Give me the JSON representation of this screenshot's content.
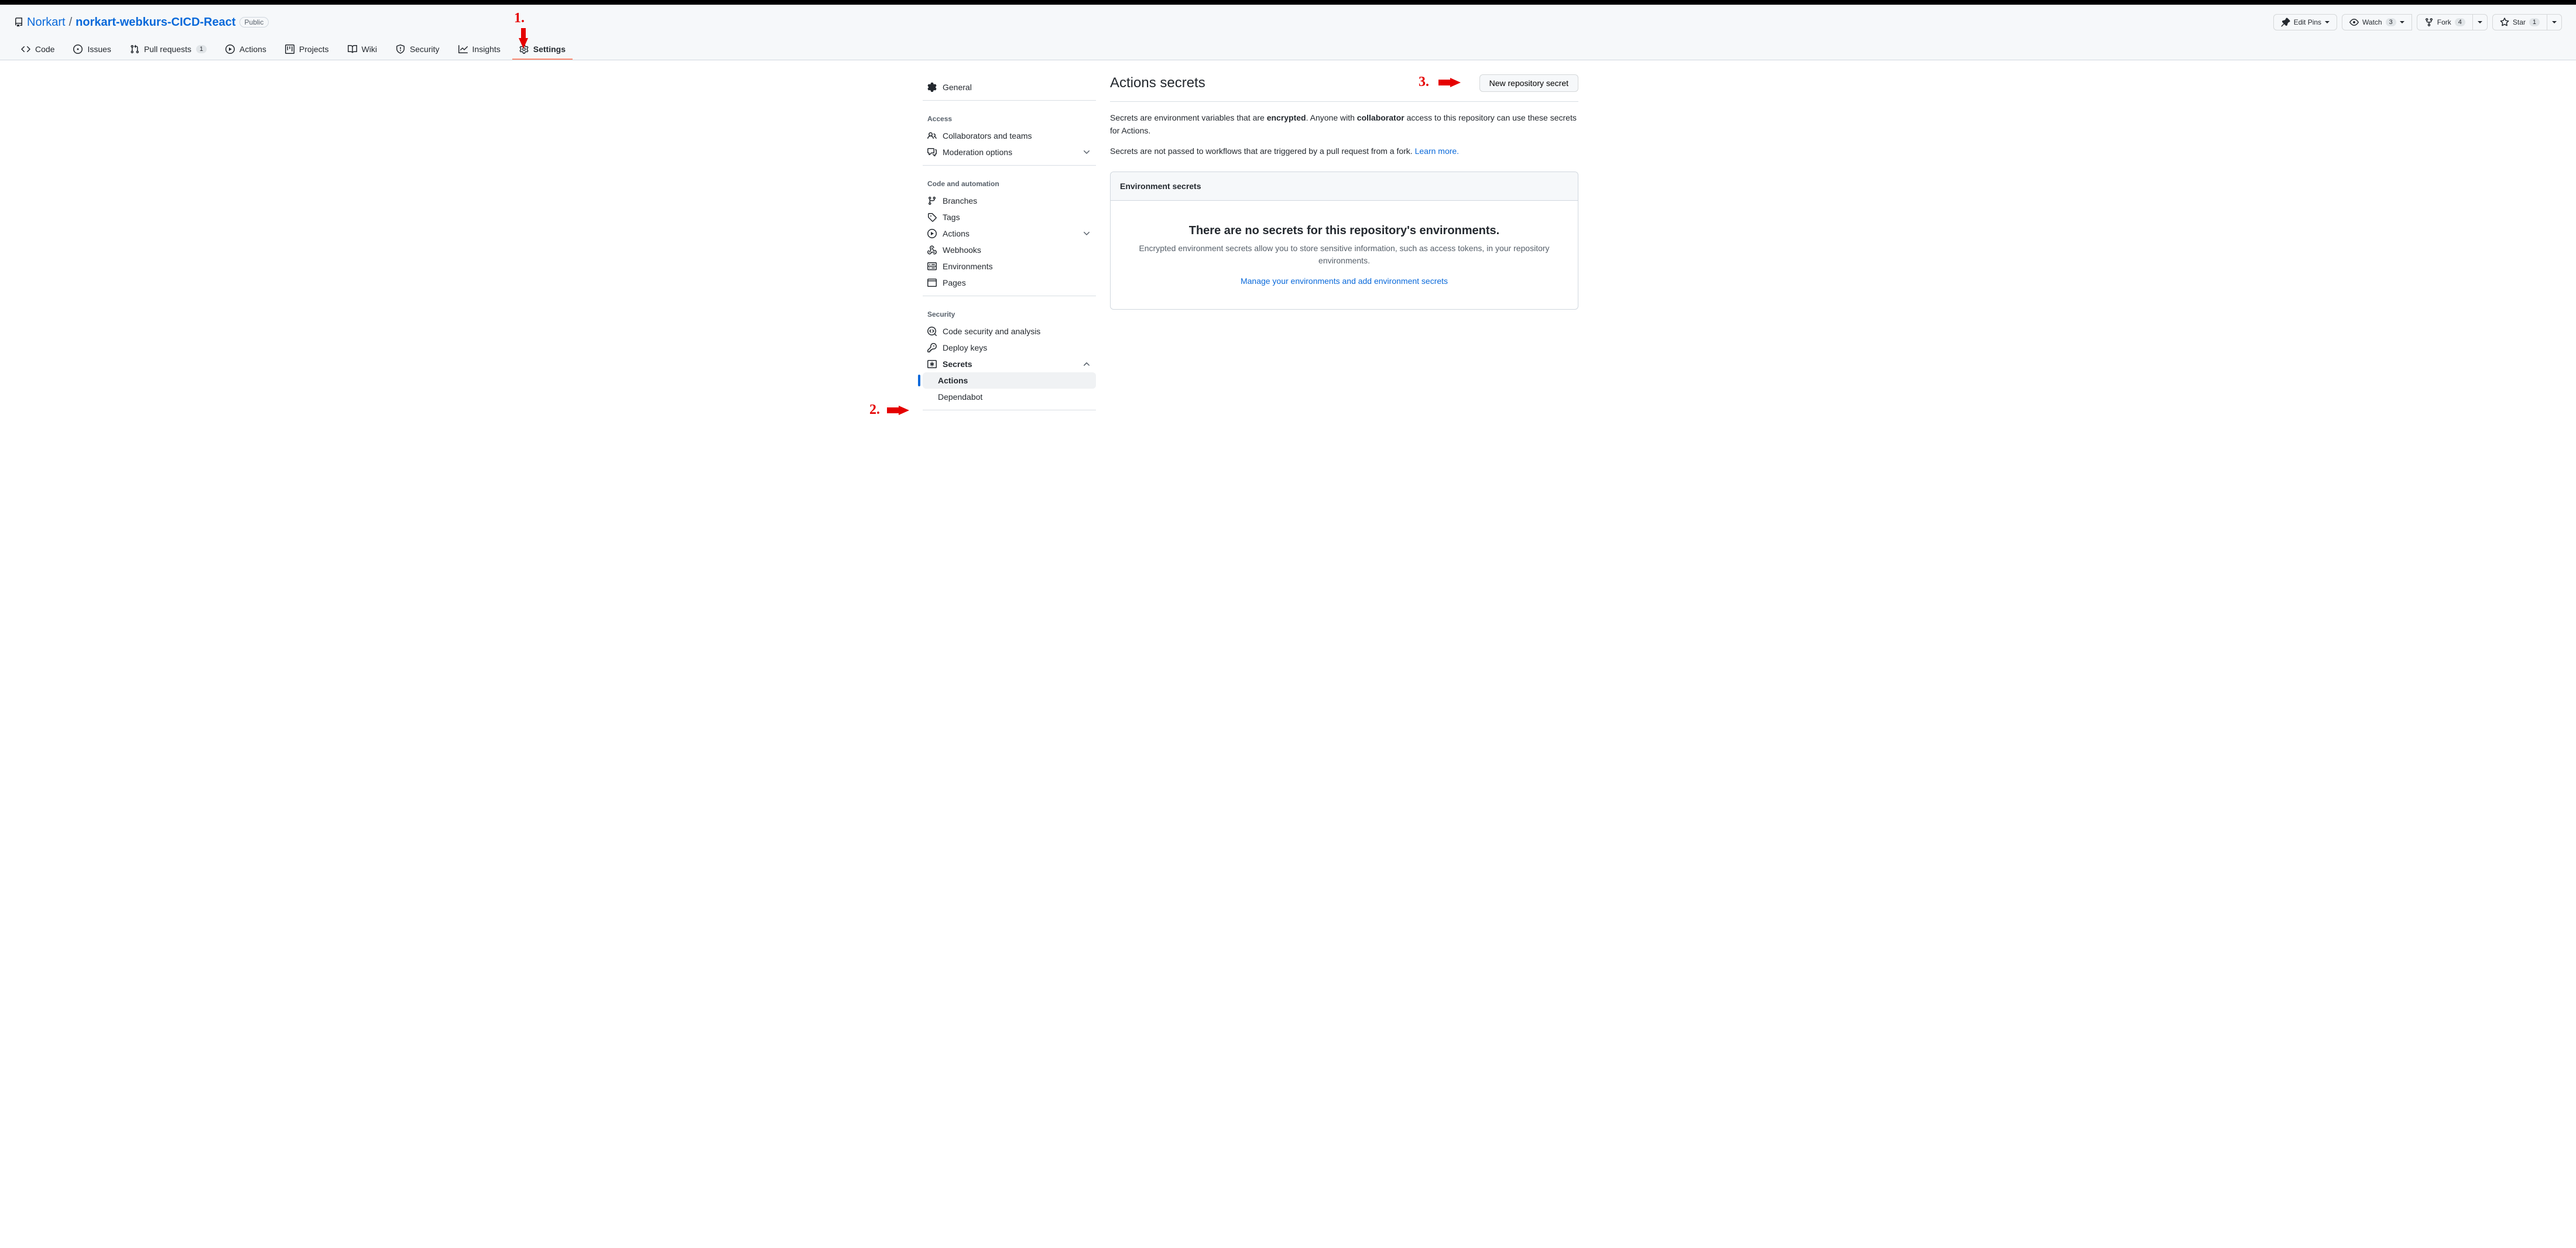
{
  "repo": {
    "owner": "Norkart",
    "name": "norkart-webkurs-CICD-React",
    "visibility": "Public"
  },
  "header_actions": {
    "edit_pins": "Edit Pins",
    "watch": "Watch",
    "watch_count": "3",
    "fork": "Fork",
    "fork_count": "4",
    "star": "Star",
    "star_count": "1"
  },
  "tabs": {
    "code": "Code",
    "issues": "Issues",
    "pulls": "Pull requests",
    "pulls_count": "1",
    "actions": "Actions",
    "projects": "Projects",
    "wiki": "Wiki",
    "security": "Security",
    "insights": "Insights",
    "settings": "Settings"
  },
  "sidebar": {
    "general": "General",
    "access_h": "Access",
    "collab": "Collaborators and teams",
    "moderation": "Moderation options",
    "code_h": "Code and automation",
    "branches": "Branches",
    "tags": "Tags",
    "actions": "Actions",
    "webhooks": "Webhooks",
    "environments": "Environments",
    "pages": "Pages",
    "security_h": "Security",
    "codesec": "Code security and analysis",
    "deploykeys": "Deploy keys",
    "secrets": "Secrets",
    "secrets_actions": "Actions",
    "secrets_dependabot": "Dependabot"
  },
  "main": {
    "title": "Actions secrets",
    "new_button": "New repository secret",
    "desc1_a": "Secrets are environment variables that are ",
    "desc1_b": "encrypted",
    "desc1_c": ". Anyone with ",
    "desc1_d": "collaborator",
    "desc1_e": " access to this repository can use these secrets for Actions.",
    "desc2_a": "Secrets are not passed to workflows that are triggered by a pull request from a fork. ",
    "desc2_link": "Learn more.",
    "box_title": "Environment secrets",
    "empty_h": "There are no secrets for this repository's environments.",
    "empty_p": "Encrypted environment secrets allow you to store sensitive information, such as access tokens, in your repository environments.",
    "empty_link": "Manage your environments and add environment secrets"
  },
  "annotations": {
    "a1": "1.",
    "a2": "2.",
    "a3": "3."
  }
}
